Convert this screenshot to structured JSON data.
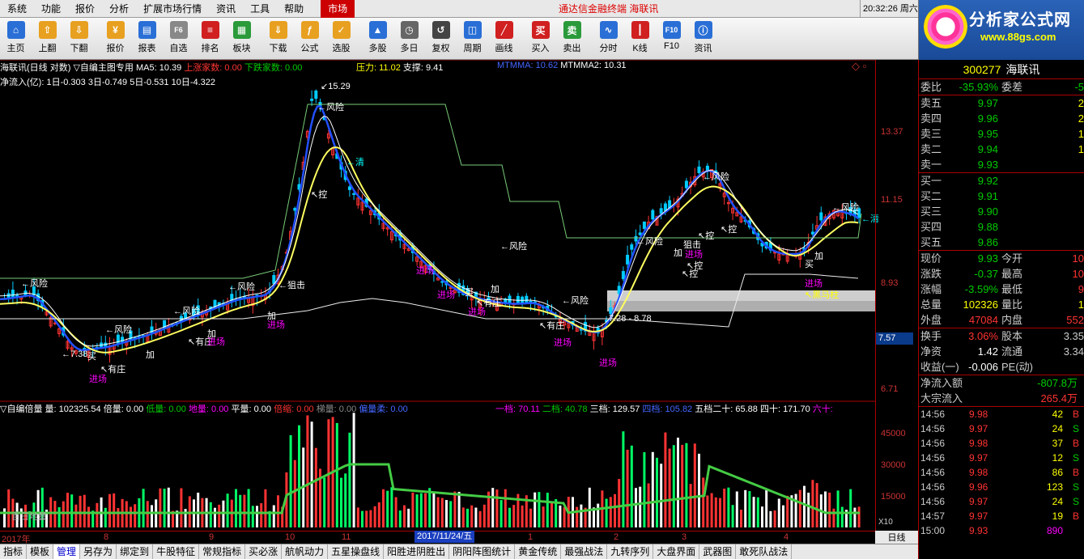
{
  "menu": {
    "items": [
      "系统",
      "功能",
      "报价",
      "分析",
      "扩展市场行情",
      "资讯",
      "工具",
      "帮助"
    ],
    "market_tab": "市场"
  },
  "app_title": "通达信金融终端 海联讯",
  "clock": "20:32:26 周六",
  "logo": {
    "brand": "分析家公式网",
    "url": "www.88gs.com"
  },
  "toolbar": [
    {
      "label": "主页",
      "icon": "home-icon",
      "color": "#2a6fd6"
    },
    {
      "label": "上翻",
      "icon": "arrow-up-icon",
      "color": "#e8a020"
    },
    {
      "label": "下翻",
      "icon": "arrow-down-icon",
      "color": "#e8a020"
    },
    {
      "label": "报价",
      "icon": "yuan-icon",
      "color": "#e8a020"
    },
    {
      "label": "报表",
      "icon": "report-icon",
      "color": "#2a6fd6"
    },
    {
      "label": "自选",
      "icon": "f6-icon",
      "color": "#888"
    },
    {
      "label": "排名",
      "icon": "ranking-icon",
      "color": "#d02020"
    },
    {
      "label": "板块",
      "icon": "blocks-icon",
      "color": "#2a9a3a"
    },
    {
      "label": "下载",
      "icon": "download-icon",
      "color": "#e8a020"
    },
    {
      "label": "公式",
      "icon": "formula-icon",
      "color": "#e8a020"
    },
    {
      "label": "选股",
      "icon": "stock-pick-icon",
      "color": "#e8a020"
    },
    {
      "label": "多股",
      "icon": "multi-stock-icon",
      "color": "#2a6fd6"
    },
    {
      "label": "多日",
      "icon": "multi-day-icon",
      "color": "#666"
    },
    {
      "label": "复权",
      "icon": "restore-icon",
      "color": "#444"
    },
    {
      "label": "周期",
      "icon": "period-icon",
      "color": "#2a6fd6"
    },
    {
      "label": "画线",
      "icon": "draw-line-icon",
      "color": "#d02020"
    },
    {
      "label": "买入",
      "icon": "buy-icon",
      "color": "#d02020"
    },
    {
      "label": "卖出",
      "icon": "sell-icon",
      "color": "#2a9a3a"
    },
    {
      "label": "分时",
      "icon": "intraday-icon",
      "color": "#2a6fd6"
    },
    {
      "label": "K线",
      "icon": "kline-icon",
      "color": "#d02020"
    },
    {
      "label": "F10",
      "icon": "f10-icon",
      "color": "#2a6fd6"
    },
    {
      "label": "资讯",
      "icon": "news-icon",
      "color": "#2a6fd6"
    }
  ],
  "main_header": {
    "name": "海联讯(日线 对数)",
    "indicator": "▽自编主图专用",
    "ma5": "MA5: 10.39",
    "up_count": "上涨家数: 0.00",
    "down_count": "下跌家数: 0.00",
    "pressure": "压力: 11.02",
    "support": "支撑: 9.41",
    "mtmma": "MTMMA: 10.62",
    "mtmma2": "MTMMA2: 10.31"
  },
  "flow_header": {
    "label": "净流入(亿):",
    "d1": "1日-0.303",
    "d3": "3日-0.749",
    "d5": "5日-0.531",
    "d10": "10日-4.322"
  },
  "price_axis": [
    "13.37",
    "11.15",
    "8.93",
    "7.57",
    "6.71"
  ],
  "current_price_tag": "7.57",
  "annotations": {
    "high": "15.29",
    "low": "7.38",
    "range": "7.28 - 8.78",
    "risk": "←风险",
    "enter": "进场",
    "add": "加",
    "control": "控",
    "clear": "清",
    "block": "狙击",
    "dealer": "有庄",
    "buy": "买",
    "black_horse": "↖黑马柱"
  },
  "vol_header": {
    "title": "▽自编倍量",
    "vol": "量: 102325.54",
    "bei": "倍量: 0.00",
    "low": "低量: 0.00",
    "ground": "地量: 0.00",
    "flat": "平量: 0.00",
    "shrink": "倍缩: 0.00",
    "ladder": "梯量: 0.00",
    "tilt": "偏量柔: 0.00",
    "g1": "一档: 70.11",
    "g2": "二档: 40.78",
    "g3": "三档: 129.57",
    "g4": "四档: 105.82",
    "g5": "五档二十: 65.88",
    "g40": "四十: 171.70",
    "g60": "六十:"
  },
  "vol_axis": [
    "45000",
    "30000",
    "15000"
  ],
  "vol_label": "百日地量",
  "x10": "X10",
  "date_axis": [
    "2017年",
    "8",
    "9",
    "10",
    "11",
    "1",
    "2",
    "3",
    "4"
  ],
  "date_selected": "2017/11/24/五",
  "day_line": "日线",
  "bottom_tabs": [
    "指标",
    "模板",
    "管理",
    "另存为",
    "绑定到",
    "牛股特征",
    "常规指标",
    "买必涨",
    "航帆动力",
    "五星操盘线",
    "阳胜进阴胜出",
    "阴阳阵图统计",
    "黄金传统",
    "最强战法",
    "九转序列",
    "大盘界面",
    "武器图",
    "敢死队战法"
  ],
  "panel": {
    "code": "300277",
    "name": "海联讯",
    "weibi": {
      "k": "委比",
      "v": "-35.93%",
      "k2": "委差",
      "q": "-5"
    },
    "asks": [
      {
        "k": "卖五",
        "v": "9.97",
        "q": "2"
      },
      {
        "k": "卖四",
        "v": "9.96",
        "q": "2"
      },
      {
        "k": "卖三",
        "v": "9.95",
        "q": "1"
      },
      {
        "k": "卖二",
        "v": "9.94",
        "q": "1"
      },
      {
        "k": "卖一",
        "v": "9.93",
        "q": ""
      }
    ],
    "bids": [
      {
        "k": "买一",
        "v": "9.92",
        "q": ""
      },
      {
        "k": "买二",
        "v": "9.91",
        "q": ""
      },
      {
        "k": "买三",
        "v": "9.90",
        "q": ""
      },
      {
        "k": "买四",
        "v": "9.88",
        "q": ""
      },
      {
        "k": "买五",
        "v": "9.86",
        "q": ""
      }
    ],
    "stats": [
      {
        "k": "现价",
        "v": "9.93",
        "k2": "今开",
        "q": "10"
      },
      {
        "k": "涨跌",
        "v": "-0.37",
        "k2": "最高",
        "q": "10"
      },
      {
        "k": "涨幅",
        "v": "-3.59%",
        "k2": "最低",
        "q": "9"
      },
      {
        "k": "总量",
        "v": "102326",
        "k2": "量比",
        "q": "1"
      },
      {
        "k": "外盘",
        "v": "47084",
        "k2": "内盘",
        "q": "552"
      }
    ],
    "stats2": [
      {
        "k": "换手",
        "v": "3.06%",
        "k2": "股本",
        "q": "3.35"
      },
      {
        "k": "净资",
        "v": "1.42",
        "k2": "流通",
        "q": "3.34"
      },
      {
        "k": "收益(一)",
        "v": "-0.006",
        "k2": "PE(动)",
        "q": ""
      }
    ],
    "flows": [
      {
        "k": "净流入额",
        "v": "-807.8万"
      },
      {
        "k": "大宗流入",
        "v": "265.4万"
      }
    ],
    "ticks": [
      {
        "t": "14:56",
        "p": "9.98",
        "n": "42",
        "s": "B"
      },
      {
        "t": "14:56",
        "p": "9.97",
        "n": "24",
        "s": "S"
      },
      {
        "t": "14:56",
        "p": "9.98",
        "n": "37",
        "s": "B"
      },
      {
        "t": "14:56",
        "p": "9.97",
        "n": "12",
        "s": "S"
      },
      {
        "t": "14:56",
        "p": "9.98",
        "n": "86",
        "s": "B"
      },
      {
        "t": "14:56",
        "p": "9.96",
        "n": "123",
        "s": "S"
      },
      {
        "t": "14:56",
        "p": "9.97",
        "n": "24",
        "s": "S"
      },
      {
        "t": "14:57",
        "p": "9.97",
        "n": "19",
        "s": "B"
      },
      {
        "t": "15:00",
        "p": "9.93",
        "n": "890",
        "s": ""
      }
    ]
  }
}
